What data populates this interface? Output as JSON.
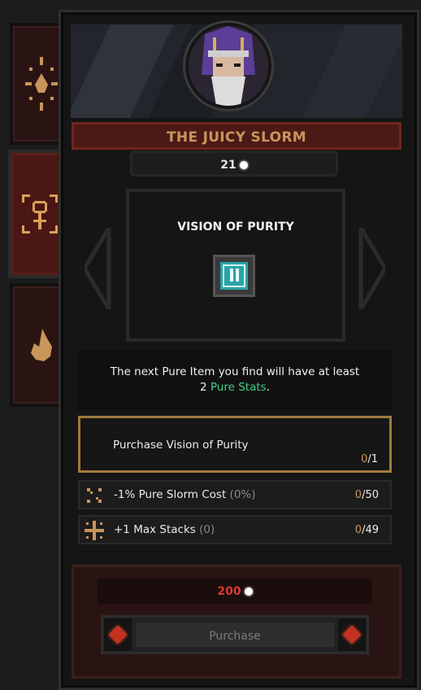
{
  "sidebar": {
    "tabs": [
      {
        "icon": "flame-star-icon",
        "active": false
      },
      {
        "icon": "target-figure-icon",
        "active": true
      },
      {
        "icon": "flame-icon",
        "active": false
      }
    ]
  },
  "header": {
    "character_icon": "wizard-portrait-icon",
    "title": "THE JUICY SLORM"
  },
  "currency": {
    "amount": "21",
    "icon": "slorm-gem-icon"
  },
  "item": {
    "name": "VISION OF PURITY",
    "icon": "pure-item-icon",
    "description_line1": "The next Pure Item you find will have at least",
    "description_line2_number": "2",
    "description_line2_highlight": "Pure Stats",
    "description_line2_end": "."
  },
  "upgrades": [
    {
      "label": "Purchase Vision of Purity",
      "muted": "",
      "current": "0",
      "max": "/1",
      "icon": "",
      "selected": true
    },
    {
      "label": "-1% Pure Slorm Cost",
      "muted": "(0%)",
      "current": "0",
      "max": "/50",
      "icon": "crossed-arrows-icon",
      "selected": false
    },
    {
      "label": "+1 Max Stacks",
      "muted": "(0)",
      "current": "0",
      "max": "/49",
      "icon": "cross-plus-icon",
      "selected": false
    }
  ],
  "purchase": {
    "price": "200",
    "price_icon": "slorm-gem-icon",
    "button_label": "Purchase"
  },
  "colors": {
    "accent_gold": "#c8955a",
    "title_bar": "#4c1a16",
    "highlight_green": "#3fd08a",
    "price_red": "#d83a2f"
  }
}
